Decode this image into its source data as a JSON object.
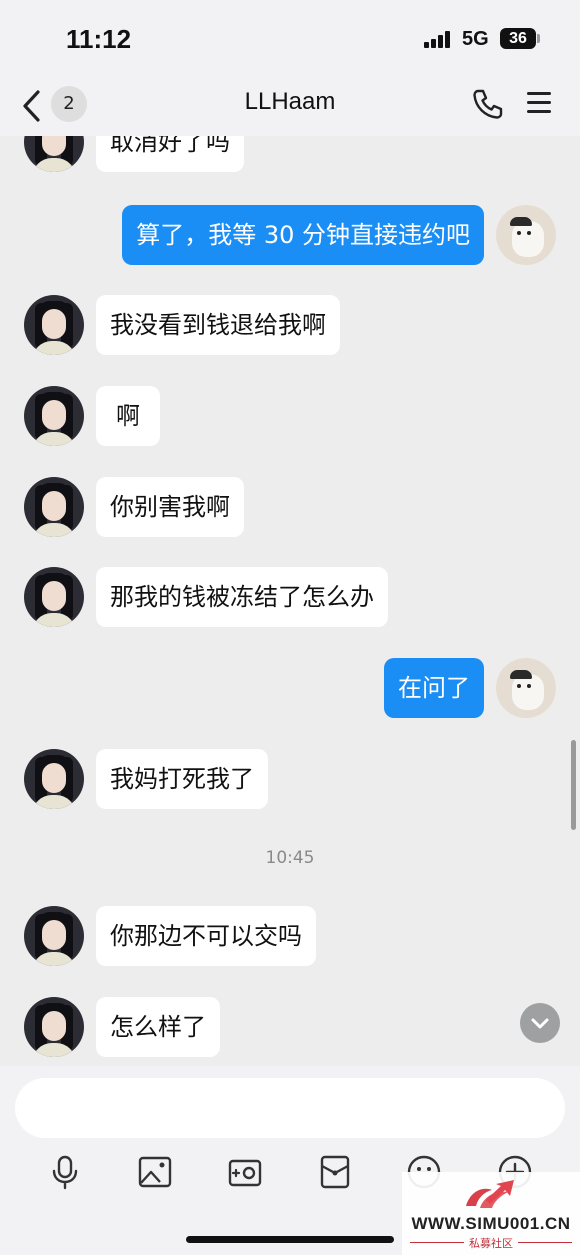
{
  "status_bar": {
    "time": "11:12",
    "network": "5G",
    "battery": "36"
  },
  "nav": {
    "unread_count": "2",
    "title": "LLHaam",
    "icons": [
      "chevron-left-icon",
      "phone-icon",
      "menu-icon"
    ]
  },
  "messages": [
    {
      "side": "in",
      "text": "取消好了吗"
    },
    {
      "side": "out",
      "text": "算了，我等 30 分钟直接违约吧"
    },
    {
      "side": "in",
      "text": "我没看到钱退给我啊"
    },
    {
      "side": "in",
      "text": "啊"
    },
    {
      "side": "in",
      "text": "你别害我啊"
    },
    {
      "side": "in",
      "text": "那我的钱被冻结了怎么办"
    },
    {
      "side": "out",
      "text": "在问了"
    },
    {
      "side": "in",
      "text": "我妈打死我了"
    },
    {
      "side": "in",
      "text": "你那边不可以交吗"
    },
    {
      "side": "in",
      "text": "怎么样了"
    }
  ],
  "timestamp": "10:45",
  "input": {
    "placeholder": ""
  },
  "toolbar": [
    "microphone-icon",
    "image-icon",
    "camera-icon",
    "red-packet-icon",
    "emoji-icon",
    "plus-icon"
  ],
  "colors": {
    "outgoing_bubble": "#1b8ef5",
    "incoming_bubble": "#ffffff",
    "background": "#ededed"
  },
  "watermark": {
    "site": "WWW.SIMU001.CN",
    "sub": "私募社区"
  }
}
